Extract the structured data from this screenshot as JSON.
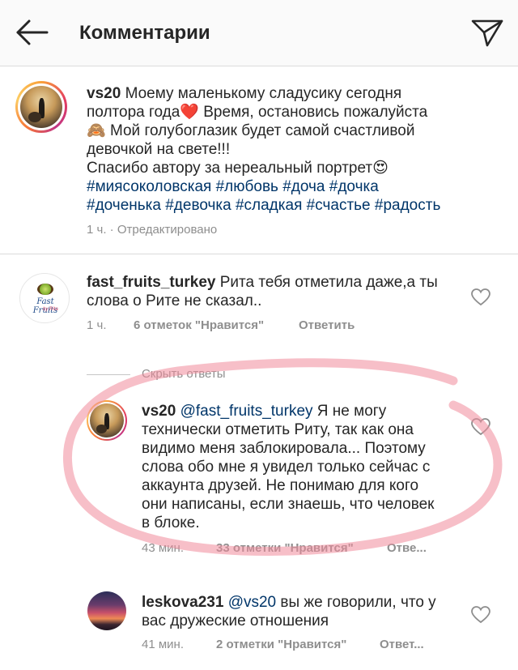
{
  "header": {
    "title": "Комментарии",
    "back_icon": "arrow-left-icon",
    "send_icon": "paper-plane-icon"
  },
  "caption": {
    "username": "vs20",
    "text_parts": {
      "line1": "Моему маленькому сладусику сегодня",
      "line2a": "полтора года",
      "line2b": " Время, остановись пожалуйста",
      "line3": " Мой голубоглазик будет самой счастливой",
      "line4": "девочкой на свете!!!",
      "line5": "Спасибо автору за нереальный портрет",
      "hashtags1": "#миясоколовская #любовь #доча #дочка",
      "hashtags2": "#доченька #девочка #сладкая #счастье #радость"
    },
    "emoji": {
      "heart": "❤️",
      "monkey": "🙈",
      "heart_eyes": "😍"
    },
    "meta": "1 ч. · Отредактировано"
  },
  "comments": [
    {
      "username": "fast_fruits_turkey",
      "text_line1": "Рита тебя отметила даже,а ты",
      "text_line2": "слова о Рите не сказал..",
      "time": "1 ч.",
      "likes": "6 отметок \"Нравится\"",
      "reply": "Ответить",
      "logo_text": "Fast Fruits",
      "logo_sub": "by Rita"
    }
  ],
  "hide_replies": "Скрыть ответы",
  "replies": [
    {
      "username": "vs20",
      "mention": "@fast_fruits_turkey",
      "text_line1": " Я не могу",
      "text_line2": "технически отметить Риту, так как она",
      "text_line3": "видимо меня заблокировала... Поэтому",
      "text_line4": "слова обо мне я увидел только сейчас с",
      "text_line5": "аккаунта друзей. Не понимаю для кого",
      "text_line6": "они написаны, если знаешь, что человек",
      "text_line7": "в блоке.",
      "time": "43 мин.",
      "likes": "33 отметки \"Нравится\"",
      "reply": "Отве..."
    },
    {
      "username": "leskova231",
      "mention": "@vs20",
      "text_line1": " вы же говорили, что у",
      "text_line2": "вас дружеские отношения",
      "time": "41 мин.",
      "likes": "2 отметки \"Нравится\"",
      "reply": "Ответ..."
    }
  ],
  "colors": {
    "link": "#003569",
    "meta": "#8e8e8e",
    "highlight_circle": "#f08a9a"
  }
}
